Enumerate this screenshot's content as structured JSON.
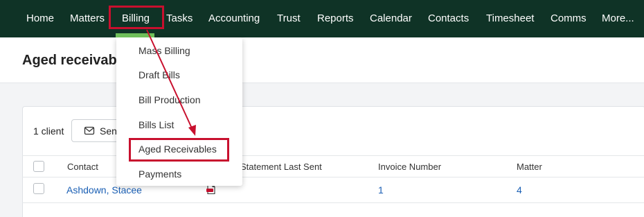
{
  "nav": {
    "items": [
      {
        "label": "Home"
      },
      {
        "label": "Matters"
      },
      {
        "label": "Billing"
      },
      {
        "label": "Tasks"
      },
      {
        "label": "Accounting"
      },
      {
        "label": "Trust"
      },
      {
        "label": "Reports"
      },
      {
        "label": "Calendar"
      },
      {
        "label": "Contacts"
      },
      {
        "label": "Timesheet"
      },
      {
        "label": "Comms"
      },
      {
        "label": "More..."
      }
    ],
    "active": "Billing"
  },
  "page": {
    "title": "Aged receivables"
  },
  "toolbar": {
    "client_count": "1 client",
    "send_label": "Send"
  },
  "table": {
    "columns": [
      "Contact",
      "Statement Last Sent",
      "Invoice Number",
      "Matter"
    ],
    "rows": [
      {
        "contact": "Ashdown, Stacee",
        "invoice_number": "1",
        "matter": "4"
      }
    ]
  },
  "billing_menu": {
    "items": [
      {
        "label": "Mass Billing"
      },
      {
        "label": "Draft Bills"
      },
      {
        "label": "Bill Production"
      },
      {
        "label": "Bills List"
      },
      {
        "label": "Aged Receivables"
      },
      {
        "label": "Payments"
      }
    ],
    "highlighted": "Aged Receivables"
  },
  "colors": {
    "nav_bg": "#0f3326",
    "nav_active": "#6fbf5a",
    "annotation_red": "#c8102e",
    "link_blue": "#1a5fb4"
  },
  "icons": [
    "mail-icon",
    "pdf-icon",
    "annotation-arrow"
  ]
}
